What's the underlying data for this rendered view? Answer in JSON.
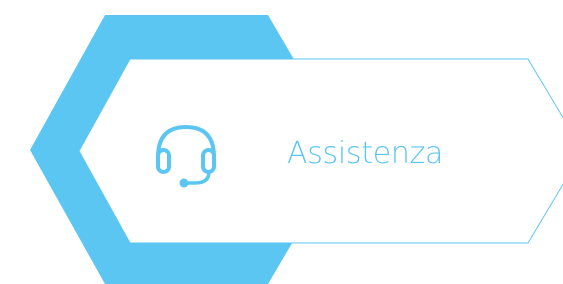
{
  "support_card": {
    "label": "Assistenza",
    "icon": "headset-icon"
  },
  "colors": {
    "accent": "#5cc6f2",
    "panel_fill": "#ffffff",
    "background": "#ffffff"
  }
}
